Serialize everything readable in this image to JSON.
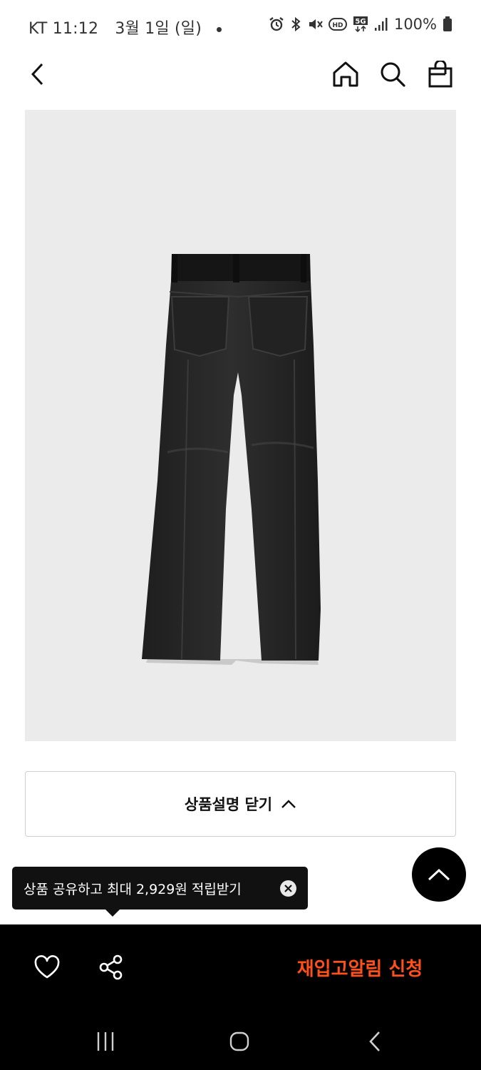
{
  "status_bar": {
    "carrier_time": "KT 11:12",
    "date": "3월 1일 (일)",
    "battery": "100%",
    "icons": [
      "alarm-icon",
      "bluetooth-icon",
      "mute-icon",
      "hd-icon",
      "5g-icon",
      "signal-icon",
      "battery-icon"
    ]
  },
  "header": {
    "icons": [
      "back-arrow-icon",
      "home-icon",
      "search-icon",
      "shopping-bag-icon"
    ]
  },
  "product": {
    "image_background": "#ebebeb",
    "image_icon": "black-jeans-back-view"
  },
  "description_toggle": {
    "label": "상품설명 닫기",
    "icon": "chevron-up-icon"
  },
  "share_tooltip": {
    "text": "상품 공유하고 최대 2,929원 적립받기",
    "close_icon": "close-circle-icon"
  },
  "bottom_bar": {
    "wishlist_icon": "heart-icon",
    "share_icon": "share-icon",
    "restock_label": "재입고알림 신청",
    "accent_color": "#ff4f1a"
  },
  "system_nav": {
    "icons": [
      "recent-apps-icon",
      "home-button-icon",
      "back-button-icon"
    ]
  }
}
